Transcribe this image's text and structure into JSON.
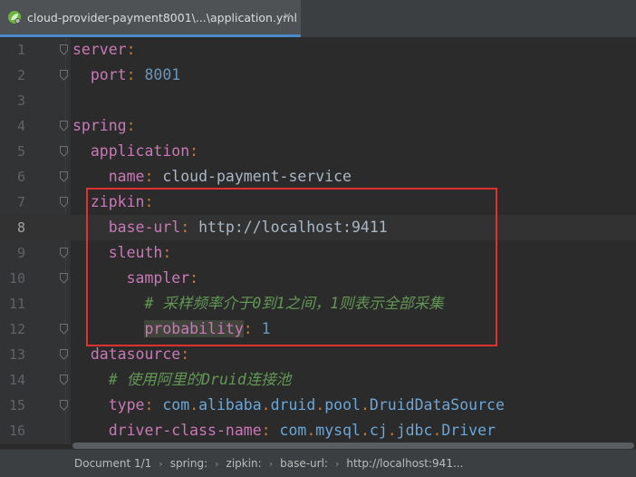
{
  "tab": {
    "title": "cloud-provider-payment8001\\...\\application.yml",
    "close_glyph": "✕",
    "icon": "spring-leaf-icon"
  },
  "editor": {
    "lines": [
      {
        "n": "1",
        "tokens": [
          {
            "t": "server",
            "c": "key"
          },
          {
            "t": ":",
            "c": "punc"
          }
        ]
      },
      {
        "n": "2",
        "tokens": [
          {
            "t": "  "
          },
          {
            "t": "port",
            "c": "key"
          },
          {
            "t": ":",
            "c": "punc"
          },
          {
            "t": " "
          },
          {
            "t": "8001",
            "c": "num"
          }
        ]
      },
      {
        "n": "3",
        "tokens": []
      },
      {
        "n": "4",
        "tokens": [
          {
            "t": "spring",
            "c": "key"
          },
          {
            "t": ":",
            "c": "punc"
          }
        ]
      },
      {
        "n": "5",
        "tokens": [
          {
            "t": "  "
          },
          {
            "t": "application",
            "c": "key"
          },
          {
            "t": ":",
            "c": "punc"
          }
        ]
      },
      {
        "n": "6",
        "tokens": [
          {
            "t": "    "
          },
          {
            "t": "name",
            "c": "key"
          },
          {
            "t": ":",
            "c": "punc"
          },
          {
            "t": " cloud-payment-service",
            "c": "str"
          }
        ]
      },
      {
        "n": "7",
        "tokens": [
          {
            "t": "  "
          },
          {
            "t": "zipkin",
            "c": "key"
          },
          {
            "t": ":",
            "c": "punc"
          }
        ]
      },
      {
        "n": "8",
        "tokens": [
          {
            "t": "    "
          },
          {
            "t": "base-url",
            "c": "key"
          },
          {
            "t": ":",
            "c": "punc"
          },
          {
            "t": " http://localhost:9411",
            "c": "str"
          }
        ]
      },
      {
        "n": "9",
        "tokens": [
          {
            "t": "    "
          },
          {
            "t": "sleuth",
            "c": "key"
          },
          {
            "t": ":",
            "c": "punc"
          }
        ]
      },
      {
        "n": "10",
        "tokens": [
          {
            "t": "      "
          },
          {
            "t": "sampler",
            "c": "key"
          },
          {
            "t": ":",
            "c": "punc"
          }
        ]
      },
      {
        "n": "11",
        "tokens": [
          {
            "t": "        "
          },
          {
            "t": "# 采样频率介于0到1之间，1则表示全部采集",
            "c": "com"
          }
        ]
      },
      {
        "n": "12",
        "tokens": [
          {
            "t": "        "
          },
          {
            "t": "probability",
            "c": "key",
            "hl": true
          },
          {
            "t": ":",
            "c": "punc"
          },
          {
            "t": " 1",
            "c": "num"
          }
        ]
      },
      {
        "n": "13",
        "tokens": [
          {
            "t": "  "
          },
          {
            "t": "datasource",
            "c": "key"
          },
          {
            "t": ":",
            "c": "punc"
          }
        ]
      },
      {
        "n": "14",
        "tokens": [
          {
            "t": "    "
          },
          {
            "t": "# 使用阿里的Druid连接池",
            "c": "com"
          }
        ]
      },
      {
        "n": "15",
        "tokens": [
          {
            "t": "    "
          },
          {
            "t": "type",
            "c": "key"
          },
          {
            "t": ":",
            "c": "punc"
          },
          {
            "t": " "
          },
          {
            "t": "com",
            "c": "cls"
          },
          {
            "t": ".",
            "c": "punc"
          },
          {
            "t": "alibaba",
            "c": "cls"
          },
          {
            "t": ".",
            "c": "punc"
          },
          {
            "t": "druid",
            "c": "cls"
          },
          {
            "t": ".",
            "c": "punc"
          },
          {
            "t": "pool",
            "c": "cls"
          },
          {
            "t": ".",
            "c": "punc"
          },
          {
            "t": "DruidDataSource",
            "c": "cls"
          }
        ]
      },
      {
        "n": "16",
        "tokens": [
          {
            "t": "    "
          },
          {
            "t": "driver-class-name",
            "c": "key"
          },
          {
            "t": ":",
            "c": "punc"
          },
          {
            "t": " "
          },
          {
            "t": "com",
            "c": "cls"
          },
          {
            "t": ".",
            "c": "punc"
          },
          {
            "t": "mysql",
            "c": "cls"
          },
          {
            "t": ".",
            "c": "punc"
          },
          {
            "t": "cj",
            "c": "cls"
          },
          {
            "t": ".",
            "c": "punc"
          },
          {
            "t": "jdbc",
            "c": "cls"
          },
          {
            "t": ".",
            "c": "punc"
          },
          {
            "t": "Driver",
            "c": "cls"
          }
        ]
      }
    ],
    "current_line": "8"
  },
  "statusbar": {
    "items": [
      "Document 1/1",
      "spring:",
      "zipkin:",
      "base-url:",
      "http://localhost:941..."
    ],
    "separator": "›"
  },
  "colors": {
    "highlight_box": "#e03030",
    "tab_underline": "#4a88c7"
  }
}
